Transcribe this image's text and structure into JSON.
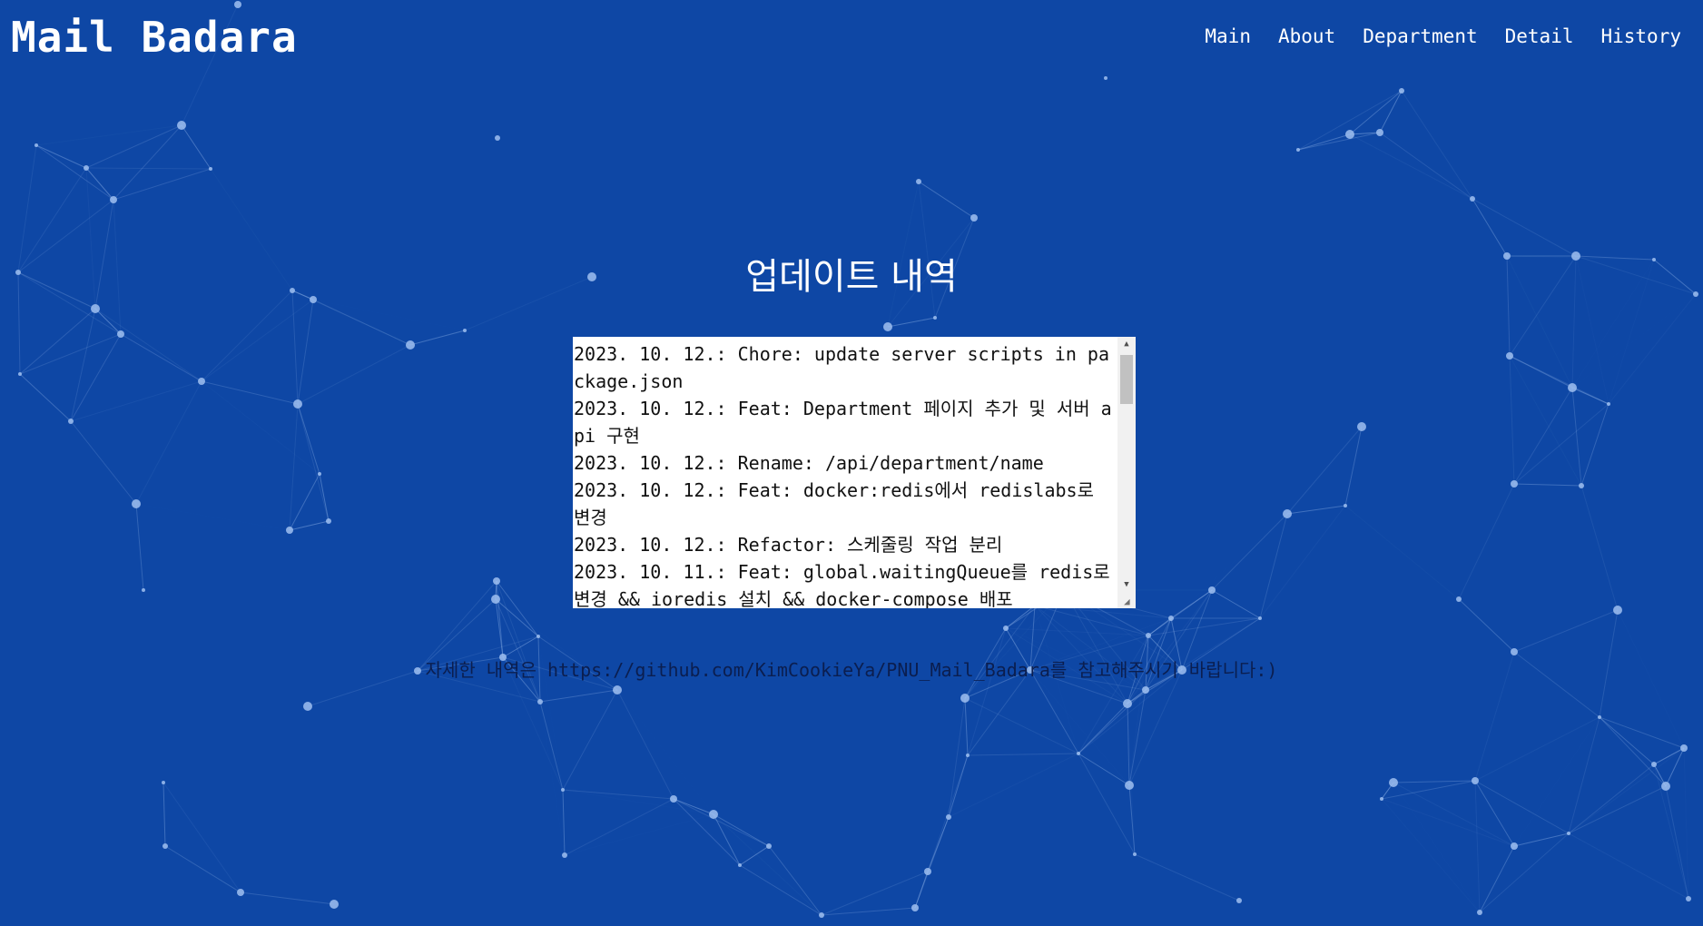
{
  "header": {
    "brand": "Mail Badara",
    "nav": [
      "Main",
      "About",
      "Department",
      "Detail",
      "History"
    ]
  },
  "main": {
    "title": "업데이트 내역",
    "log_entries": [
      "2023. 10. 12.: Chore: update server scripts in package.json",
      "2023. 10. 12.: Feat: Department 페이지 추가 및 서버 api 구현",
      "2023. 10. 12.: Rename: /api/department/name",
      "2023. 10. 12.: Feat: docker:redis에서 redislabs로 변경",
      "2023. 10. 12.: Refactor: 스케줄링 작업 분리",
      "2023. 10. 11.: Feat: global.waitingQueue를 redis로 변경 && ioredis 설치 && docker-compose 배포"
    ],
    "footnote": "자세한 내역은 https://github.com/KimCookieYa/PNU_Mail_Badara를 참고해주시기 바랍니다:)"
  },
  "colors": {
    "background": "#0e47a5",
    "network": "#9fc0f0",
    "text_light": "#ffffff",
    "text_dark": "#0b1e4f"
  },
  "icons": [
    "scroll-up-arrow-icon",
    "scroll-down-arrow-icon",
    "resize-grip-icon"
  ]
}
